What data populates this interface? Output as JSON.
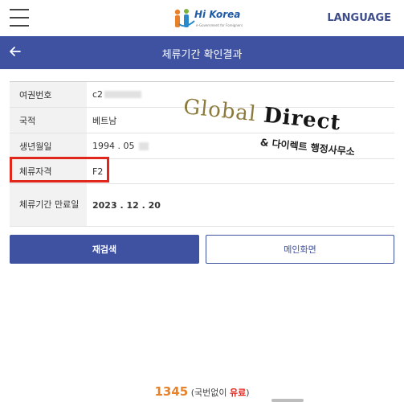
{
  "header": {
    "logo_text": "Hi Korea",
    "logo_subtext": "e-Government for Foreigners",
    "language_label": "LANGUAGE"
  },
  "titlebar": {
    "title": "체류기간 확인결과"
  },
  "result_table": [
    {
      "label": "여권번호",
      "value": "c2"
    },
    {
      "label": "국적",
      "value": "베트남"
    },
    {
      "label": "생년월일",
      "value": "1994 . 05"
    },
    {
      "label": "체류자격",
      "value": "F2"
    },
    {
      "label": "체류기간 만료일",
      "value": "2023 . 12 . 20"
    }
  ],
  "watermark": {
    "line1_a": "Global",
    "line1_b": "Direct",
    "line2": "& 다이렉트 행정사무소"
  },
  "buttons": {
    "research_label": "재검색",
    "main_label": "메인화면"
  },
  "footer": {
    "count": "1345",
    "text_prefix": "(국번없이 ",
    "text_paid": "유료",
    "text_suffix": ")"
  },
  "colors": {
    "primary": "#3f51a1",
    "highlight": "#e1261c",
    "accent": "#e8822a"
  }
}
